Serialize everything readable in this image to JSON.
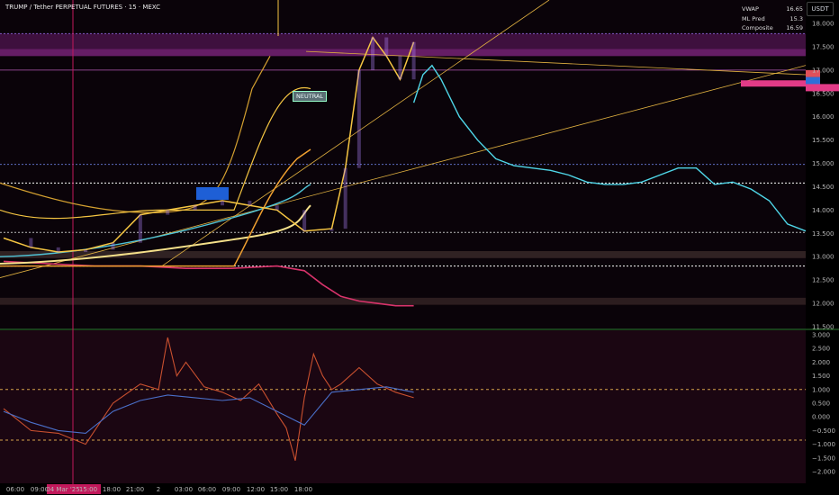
{
  "header": {
    "title": "TRUMP / Tether PERPETUAL FUTURES · 15 · MEXC",
    "currency": "USDT"
  },
  "indicators": [
    {
      "label": "VWAP",
      "value": "16.65"
    },
    {
      "label": "ML Pred",
      "value": "15.3"
    },
    {
      "label": "Composite",
      "value": "16.59"
    }
  ],
  "annotations": {
    "neutral": "NEUTRAL"
  },
  "price_axis": [
    "18.000",
    "17.500",
    "17.000",
    "16.500",
    "16.000",
    "15.500",
    "15.000",
    "14.500",
    "14.000",
    "13.500",
    "13.000",
    "12.500",
    "12.000",
    "11.500"
  ],
  "osc_axis": [
    "3.000",
    "2.500",
    "2.000",
    "1.500",
    "1.000",
    "0.500",
    "0.000",
    "−0.500",
    "−1.000",
    "−1.500",
    "−2.000"
  ],
  "time_axis": [
    "06:00",
    "09:00",
    "04 Mar '25",
    "15:00",
    "18:00",
    "21:00",
    "2",
    "03:00",
    "06:00",
    "09:00",
    "12:00",
    "15:00",
    "18:00"
  ],
  "colors": {
    "candles": "#f5c542",
    "forecast": "#4fd6e8",
    "lower_band": "#d8336b",
    "vwap": "#f5c542",
    "zone": "#6a1b6a",
    "osc_fast": "#c9502f",
    "osc_slow": "#4a6fc9"
  },
  "chart_data": [
    {
      "type": "line",
      "title": "TRUMP / Tether PERPETUAL FUTURES · 15 · MEXC",
      "ylim": [
        11.5,
        18.3
      ],
      "series": [
        {
          "x": [
            0,
            6,
            12,
            18,
            24,
            30,
            36,
            42,
            48,
            54,
            60,
            66,
            72,
            75,
            78,
            81,
            84,
            87,
            90
          ],
          "values": [
            13.4,
            13.2,
            13.1,
            13.15,
            13.3,
            13.9,
            14.0,
            14.1,
            14.2,
            14.1,
            14.0,
            13.55,
            13.6,
            14.9,
            17.0,
            17.7,
            17.3,
            16.8,
            17.6
          ]
        },
        {
          "name": "ML Pred",
          "x": [
            90,
            92,
            94,
            96,
            100,
            104,
            108,
            112,
            116,
            120,
            124,
            128,
            132,
            136,
            140,
            144,
            148,
            152,
            156,
            160,
            164,
            168,
            172,
            176
          ],
          "values": [
            16.3,
            16.9,
            17.1,
            16.8,
            16.0,
            15.5,
            15.1,
            14.95,
            14.9,
            14.85,
            14.75,
            14.6,
            14.55,
            14.55,
            14.6,
            14.75,
            14.9,
            14.9,
            14.55,
            14.6,
            14.45,
            14.2,
            13.7,
            13.55
          ]
        },
        {
          "x": [
            0,
            10,
            20,
            30,
            40,
            50,
            60,
            66,
            70,
            74,
            78,
            82,
            86,
            90
          ],
          "values": [
            12.9,
            12.85,
            12.8,
            12.8,
            12.75,
            12.75,
            12.8,
            12.7,
            12.4,
            12.15,
            12.05,
            12.0,
            11.95,
            11.95
          ]
        }
      ]
    },
    {
      "type": "line",
      "ylim": [
        -2.2,
        3.0
      ],
      "series": [
        {
          "x": [
            0,
            6,
            12,
            18,
            24,
            30,
            34,
            36,
            38,
            40,
            44,
            48,
            52,
            56,
            60,
            62,
            64,
            66,
            68,
            70,
            72,
            74,
            78,
            82,
            86,
            90
          ],
          "values": [
            0.3,
            -0.5,
            -0.6,
            -1.0,
            0.5,
            1.2,
            1.0,
            2.9,
            1.5,
            2.0,
            1.1,
            0.9,
            0.6,
            1.2,
            0.1,
            -0.4,
            -1.6,
            0.7,
            2.3,
            1.5,
            1.0,
            1.2,
            1.8,
            1.2,
            0.9,
            0.7
          ]
        },
        {
          "x": [
            0,
            6,
            12,
            18,
            24,
            30,
            36,
            42,
            48,
            54,
            60,
            66,
            72,
            78,
            84,
            90
          ],
          "values": [
            0.2,
            -0.2,
            -0.5,
            -0.6,
            0.2,
            0.6,
            0.8,
            0.7,
            0.6,
            0.7,
            0.2,
            -0.3,
            0.9,
            1.0,
            1.1,
            0.9
          ]
        }
      ]
    }
  ]
}
